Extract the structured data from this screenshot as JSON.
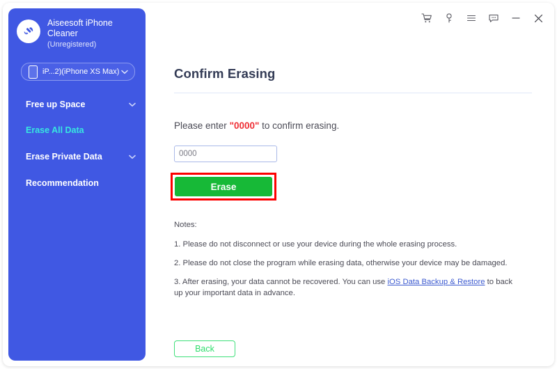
{
  "app": {
    "name_line1": "Aiseesoft iPhone",
    "name_line2": "Cleaner",
    "registration_status": "(Unregistered)",
    "logo_icon": "broom-cleaner-icon"
  },
  "sidebar": {
    "device_selector": {
      "label": "iP...2)(iPhone XS Max)",
      "device_icon": "phone-icon",
      "chevron_icon": "chevron-down-icon"
    },
    "items": [
      {
        "label": "Free up Space",
        "active": false,
        "has_chevron": true
      },
      {
        "label": "Erase All Data",
        "active": true,
        "has_chevron": false
      },
      {
        "label": "Erase Private Data",
        "active": false,
        "has_chevron": true
      },
      {
        "label": "Recommendation",
        "active": false,
        "has_chevron": false
      }
    ],
    "background_color": "#4058e3",
    "active_color": "#37e8e0"
  },
  "titlebar": {
    "icons": [
      {
        "name": "cart-icon",
        "title": "Buy"
      },
      {
        "name": "key-icon",
        "title": "Register"
      },
      {
        "name": "menu-icon",
        "title": "Menu"
      },
      {
        "name": "feedback-icon",
        "title": "Feedback"
      },
      {
        "name": "minimize-icon",
        "title": "Minimize"
      },
      {
        "name": "close-icon",
        "title": "Close"
      }
    ]
  },
  "main": {
    "title": "Confirm Erasing",
    "confirm_prefix": "Please enter ",
    "confirm_code": "\"0000\"",
    "confirm_suffix": " to confirm erasing.",
    "input_value": "0000",
    "input_placeholder": "0000",
    "erase_label": "Erase",
    "back_label": "Back",
    "erase_color": "#17b937",
    "highlight_color": "#fe0000",
    "notes_heading": "Notes:",
    "note_1": "1. Please do not disconnect or use your device during the whole erasing process.",
    "note_2": "2. Please do not close the program while erasing data, otherwise your device may be damaged.",
    "note_3_part1": "3. After erasing, your data cannot be recovered. You can use ",
    "note_3_link": "iOS Data Backup & Restore",
    "note_3_part2": " to back up your important data in advance."
  }
}
